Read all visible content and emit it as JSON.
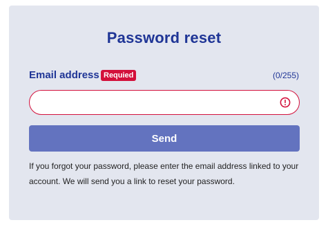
{
  "page": {
    "title": "Password reset"
  },
  "email_field": {
    "label": "Email address",
    "required_badge": "Requied",
    "counter": "(0/255)",
    "value": "",
    "placeholder": ""
  },
  "actions": {
    "send_label": "Send"
  },
  "help": {
    "text": "If you forgot your password, please enter the email address linked to your account. We will send you a link to reset your password."
  },
  "icons": {
    "error": "exclamation-circle-icon"
  },
  "colors": {
    "primary": "#1f3596",
    "error": "#d3103b",
    "button": "#6373bf",
    "card_background": "#e3e6ef"
  }
}
